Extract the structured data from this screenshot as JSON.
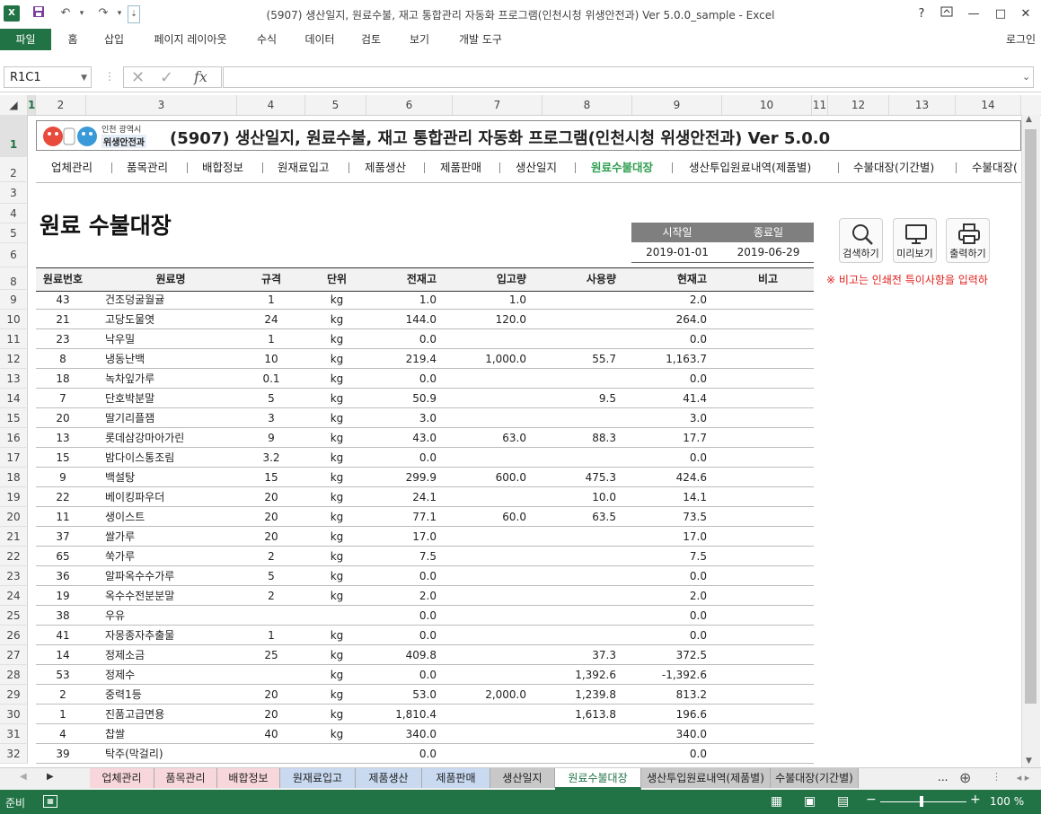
{
  "window": {
    "title": "(5907) 생산일지, 원료수불, 재고 통합관리 자동화 프로그램(인천시청 위생안전과) Ver 5.0.0_sample - Excel",
    "help": "?",
    "login": "로그인"
  },
  "ribbon": {
    "tabs": [
      "파일",
      "홈",
      "삽입",
      "페이지 레이아웃",
      "수식",
      "데이터",
      "검토",
      "보기",
      "개발 도구"
    ]
  },
  "formula_bar": {
    "name_box": "R1C1",
    "fx": "fx",
    "content": ""
  },
  "columns": [
    "1",
    "2",
    "3",
    "4",
    "5",
    "6",
    "7",
    "8",
    "9",
    "10",
    "11",
    "12",
    "13",
    "14"
  ],
  "rows": [
    "1",
    "2",
    "3",
    "4",
    "5",
    "6",
    "8",
    "9",
    "10",
    "11",
    "12",
    "13",
    "14",
    "15",
    "16",
    "17",
    "18",
    "19",
    "20",
    "21",
    "22",
    "23",
    "24",
    "25",
    "26",
    "27",
    "28",
    "29",
    "30",
    "31",
    "32"
  ],
  "banner": {
    "logo_top": "인천 광역시",
    "logo_bottom": "위생안전과",
    "title": "(5907) 생산일지, 원료수불, 재고 통합관리 자동화 프로그램(인천시청 위생안전과) Ver 5.0.0"
  },
  "nav": [
    "업체관리",
    "품목관리",
    "배합정보",
    "원재료입고",
    "제품생산",
    "제품판매",
    "생산일지",
    "원료수불대장",
    "생산투입원료내역(제품별)",
    "수불대장(기간별)",
    "수불대장("
  ],
  "nav_active_index": 7,
  "page_title": "원료 수불대장",
  "dates": {
    "start_label": "시작일",
    "end_label": "종료일",
    "start": "2019-01-01",
    "end": "2019-06-29"
  },
  "buttons": {
    "search": "검색하기",
    "preview": "미리보기",
    "print": "출력하기"
  },
  "note": "※ 비고는 인쇄전 특이사항을 입력하",
  "table": {
    "headers": [
      "원료번호",
      "원료명",
      "규격",
      "단위",
      "전재고",
      "입고량",
      "사용량",
      "현재고",
      "비고"
    ],
    "rows": [
      {
        "no": "43",
        "name": "건조덩굴월귤",
        "spec": "1",
        "unit": "kg",
        "prev": "1.0",
        "in": "1.0",
        "use": "",
        "now": "2.0"
      },
      {
        "no": "21",
        "name": "고당도물엿",
        "spec": "24",
        "unit": "kg",
        "prev": "144.0",
        "in": "120.0",
        "use": "",
        "now": "264.0"
      },
      {
        "no": "23",
        "name": "낙우밀",
        "spec": "1",
        "unit": "kg",
        "prev": "0.0",
        "in": "",
        "use": "",
        "now": "0.0"
      },
      {
        "no": "8",
        "name": "냉동난백",
        "spec": "10",
        "unit": "kg",
        "prev": "219.4",
        "in": "1,000.0",
        "use": "55.7",
        "now": "1,163.7"
      },
      {
        "no": "18",
        "name": "녹차잎가루",
        "spec": "0.1",
        "unit": "kg",
        "prev": "0.0",
        "in": "",
        "use": "",
        "now": "0.0"
      },
      {
        "no": "7",
        "name": "단호박분말",
        "spec": "5",
        "unit": "kg",
        "prev": "50.9",
        "in": "",
        "use": "9.5",
        "now": "41.4"
      },
      {
        "no": "20",
        "name": "딸기리플잼",
        "spec": "3",
        "unit": "kg",
        "prev": "3.0",
        "in": "",
        "use": "",
        "now": "3.0"
      },
      {
        "no": "13",
        "name": "롯데삼강마아가린",
        "spec": "9",
        "unit": "kg",
        "prev": "43.0",
        "in": "63.0",
        "use": "88.3",
        "now": "17.7"
      },
      {
        "no": "15",
        "name": "밤다이스통조림",
        "spec": "3.2",
        "unit": "kg",
        "prev": "0.0",
        "in": "",
        "use": "",
        "now": "0.0"
      },
      {
        "no": "9",
        "name": "백설탕",
        "spec": "15",
        "unit": "kg",
        "prev": "299.9",
        "in": "600.0",
        "use": "475.3",
        "now": "424.6"
      },
      {
        "no": "22",
        "name": "베이킹파우더",
        "spec": "20",
        "unit": "kg",
        "prev": "24.1",
        "in": "",
        "use": "10.0",
        "now": "14.1"
      },
      {
        "no": "11",
        "name": "생이스트",
        "spec": "20",
        "unit": "kg",
        "prev": "77.1",
        "in": "60.0",
        "use": "63.5",
        "now": "73.5"
      },
      {
        "no": "37",
        "name": "쌀가루",
        "spec": "20",
        "unit": "kg",
        "prev": "17.0",
        "in": "",
        "use": "",
        "now": "17.0"
      },
      {
        "no": "65",
        "name": "쑥가루",
        "spec": "2",
        "unit": "kg",
        "prev": "7.5",
        "in": "",
        "use": "",
        "now": "7.5"
      },
      {
        "no": "36",
        "name": "알파옥수수가루",
        "spec": "5",
        "unit": "kg",
        "prev": "0.0",
        "in": "",
        "use": "",
        "now": "0.0"
      },
      {
        "no": "19",
        "name": "옥수수전분분말",
        "spec": "2",
        "unit": "kg",
        "prev": "2.0",
        "in": "",
        "use": "",
        "now": "2.0"
      },
      {
        "no": "38",
        "name": "우유",
        "spec": "",
        "unit": "",
        "prev": "0.0",
        "in": "",
        "use": "",
        "now": "0.0"
      },
      {
        "no": "41",
        "name": "자몽종자추출물",
        "spec": "1",
        "unit": "kg",
        "prev": "0.0",
        "in": "",
        "use": "",
        "now": "0.0"
      },
      {
        "no": "14",
        "name": "정제소금",
        "spec": "25",
        "unit": "kg",
        "prev": "409.8",
        "in": "",
        "use": "37.3",
        "now": "372.5"
      },
      {
        "no": "53",
        "name": "정제수",
        "spec": "",
        "unit": "kg",
        "prev": "0.0",
        "in": "",
        "use": "1,392.6",
        "now": "-1,392.6"
      },
      {
        "no": "2",
        "name": "중력1등",
        "spec": "20",
        "unit": "kg",
        "prev": "53.0",
        "in": "2,000.0",
        "use": "1,239.8",
        "now": "813.2"
      },
      {
        "no": "1",
        "name": "진품고급면용",
        "spec": "20",
        "unit": "kg",
        "prev": "1,810.4",
        "in": "",
        "use": "1,613.8",
        "now": "196.6"
      },
      {
        "no": "4",
        "name": "찹쌀",
        "spec": "40",
        "unit": "kg",
        "prev": "340.0",
        "in": "",
        "use": "",
        "now": "340.0"
      },
      {
        "no": "39",
        "name": "탁주(막걸리)",
        "spec": "",
        "unit": "",
        "prev": "0.0",
        "in": "",
        "use": "",
        "now": "0.0"
      }
    ]
  },
  "sheet_tabs": [
    {
      "label": "업체관리",
      "color": "#f8d7dc"
    },
    {
      "label": "품목관리",
      "color": "#f8d7dc"
    },
    {
      "label": "배합정보",
      "color": "#f8d7dc"
    },
    {
      "label": "원재료입고",
      "color": "#c8d9f0"
    },
    {
      "label": "제품생산",
      "color": "#c8d9f0"
    },
    {
      "label": "제품판매",
      "color": "#c8d9f0"
    },
    {
      "label": "생산일지",
      "color": "#c8c8c8"
    },
    {
      "label": "원료수불대장",
      "color": "#ffffff"
    },
    {
      "label": "생산투입원료내역(제품별)",
      "color": "#c8c8c8"
    },
    {
      "label": "수불대장(기간별)",
      "color": "#c8c8c8"
    }
  ],
  "sheet_tabs_more": "...",
  "status": {
    "ready": "준비",
    "zoom": "100 %"
  },
  "colors": {
    "excel_green": "#217346",
    "nav_active": "#2e9e4f",
    "note_red": "#e0201d"
  }
}
